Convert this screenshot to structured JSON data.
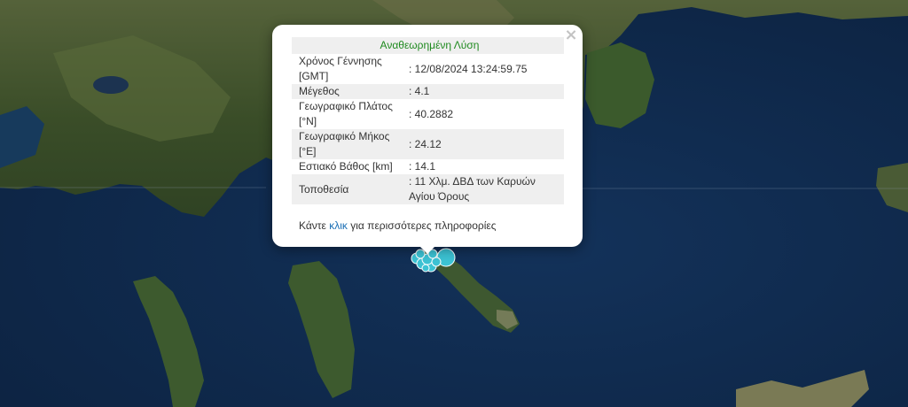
{
  "map": {
    "colors": {
      "sea_deep": "#10294a",
      "sea_shallow": "#1d4566",
      "land_dark": "#2f4421",
      "land_mid": "#4b5d32",
      "land_light": "#8a8a5e",
      "marker": "#3cc3d4",
      "marker_stroke": "#ffffff"
    },
    "marker_count": 9
  },
  "popup": {
    "title": "Αναθεωρημένη Λύση",
    "close_label": "×",
    "rows": [
      {
        "key": "Χρόνος Γέννησης [GMT]",
        "value": ": 12/08/2024 13:24:59.75"
      },
      {
        "key": "Μέγεθος",
        "value": ": 4.1"
      },
      {
        "key": "Γεωγραφικό Πλάτος [°N]",
        "value": ": 40.2882"
      },
      {
        "key": "Γεωγραφικό Μήκος [°E]",
        "value": ": 24.12"
      },
      {
        "key": "Εστιακό Βάθος [km]",
        "value": ": 14.1"
      },
      {
        "key": "Τοποθεσία",
        "value": ": 11 Χλμ. ΔΒΔ των Καρυών Αγίου Όρους"
      }
    ],
    "more_prefix": "Κάντε ",
    "more_link": "κλικ",
    "more_suffix": " για περισσότερες πληροφορίες"
  }
}
